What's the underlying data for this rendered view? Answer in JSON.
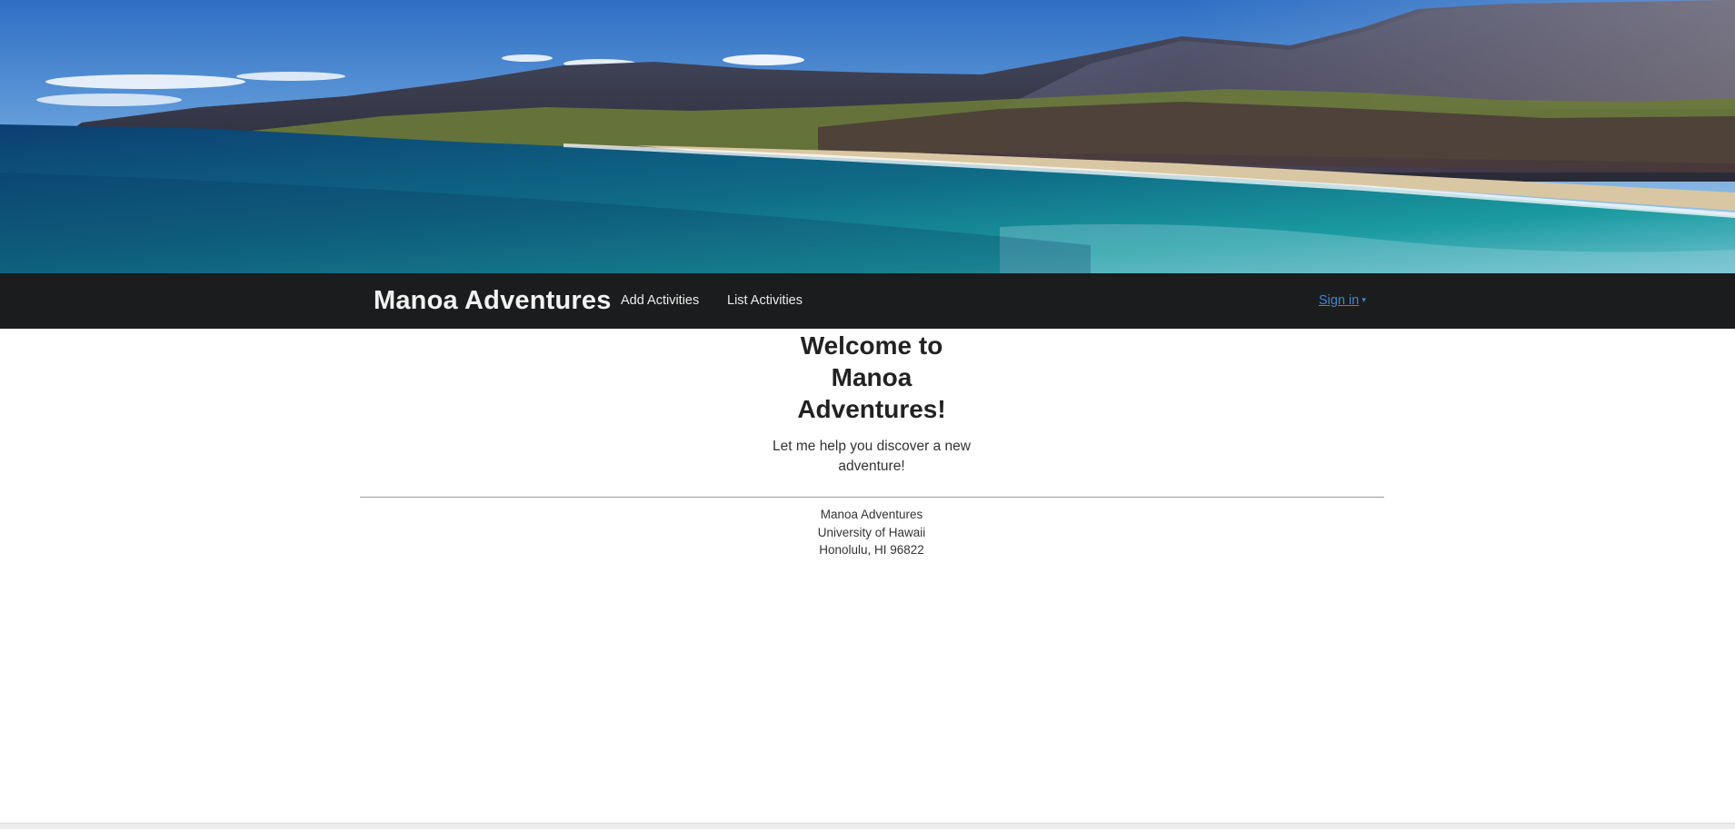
{
  "hero": {
    "image": "hawaii-coastline-landscape"
  },
  "navbar": {
    "brand": "Manoa Adventures",
    "links": [
      "Add Activities",
      "List Activities"
    ],
    "signin_label": "Sign in",
    "signin_caret": "▾"
  },
  "main": {
    "heading_lines": [
      "Welcome to",
      "Manoa",
      "Adventures!"
    ],
    "tagline_lines": [
      "Let me help you discover a new",
      "adventure!"
    ]
  },
  "footer": {
    "lines": [
      "Manoa Adventures",
      "University of Hawaii",
      "Honolulu, HI 96822"
    ]
  },
  "colors": {
    "navbar_bg": "#1b1c1d",
    "link_blue": "#3f86d8",
    "brand_text": "#f2f2f2"
  }
}
